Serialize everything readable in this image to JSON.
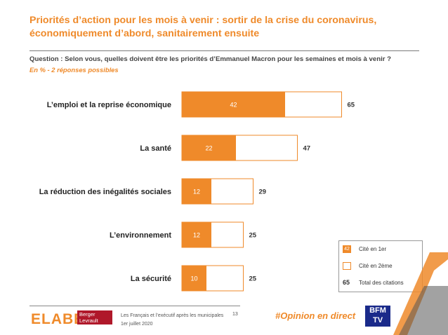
{
  "title": "Priorités d’action pour les mois à venir : sortir de la crise du coronavirus, économiquement d’abord, sanitairement ensuite",
  "question": "Question : Selon vous, quelles doivent être les priorités d’Emmanuel Macron pour les semaines et mois à venir ?",
  "subtitle": "En % - 2 réponses possibles",
  "chart_data": {
    "type": "bar",
    "orientation": "horizontal",
    "categories": [
      "L’emploi et la reprise économique",
      "La santé",
      "La réduction des inégalités sociales",
      "L’environnement",
      "La sécurité"
    ],
    "series": [
      {
        "name": "Cité en 1er",
        "values": [
          42,
          22,
          12,
          12,
          10
        ]
      },
      {
        "name": "Total des citations",
        "values": [
          65,
          47,
          29,
          25,
          25
        ]
      }
    ],
    "colors": {
      "first": "#ef8a2a",
      "outline": "#ef8a2a"
    }
  },
  "legend": {
    "first_value": "42",
    "first_label": "Cité en 1er",
    "second_label": "Cité en 2ème",
    "total_value": "65",
    "total_label": "Total des citations"
  },
  "footer": {
    "brand": "ELABE",
    "partner": "Berger Levrault",
    "line1": "Les Français et l’exécutif après les municipales",
    "line2": "1er juillet 2020",
    "page": "13",
    "hashtag": "#Opinion en direct",
    "tv": "BFM TV"
  }
}
